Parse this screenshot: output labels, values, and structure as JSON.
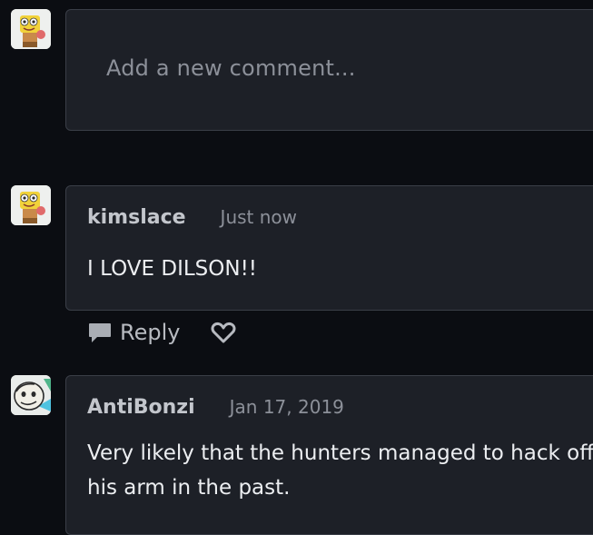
{
  "new_comment": {
    "placeholder": "Add a new comment..."
  },
  "comments": [
    {
      "username": "kimslace",
      "timestamp": "Just now",
      "text": "I LOVE DILSON!!",
      "avatar_icon": "cartoon-sponge-avatar-icon"
    },
    {
      "username": "AntiBonzi",
      "timestamp": "Jan 17, 2019",
      "text": "Very likely that the hunters managed to hack off his arm in the past.",
      "avatar_icon": "cartoon-character-avatar-icon"
    }
  ],
  "actions": {
    "reply_label": "Reply",
    "reply_icon": "speech-bubble-icon",
    "like_icon": "heart-outline-icon"
  },
  "colors": {
    "background": "#0b0d12",
    "panel": "#1d2027",
    "border": "#3a3e47",
    "muted_text": "#8c9099"
  }
}
